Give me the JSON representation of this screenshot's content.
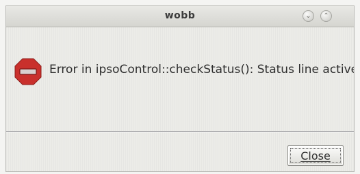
{
  "window": {
    "title": "wobb",
    "title_buttons": [
      {
        "name": "minimize",
        "icon": "chevron-down-icon",
        "glyph": "⌄"
      },
      {
        "name": "maximize",
        "icon": "chevron-up-icon",
        "glyph": "⌃"
      }
    ]
  },
  "dialog": {
    "icon": "stop-sign-icon",
    "icon_color": "#c9302c",
    "message": "Error in ipsoControl::checkStatus(): Status line active!"
  },
  "footer": {
    "close_label": "Close"
  },
  "colors": {
    "background": "#ecece8",
    "titlebar": "#d5d5d0",
    "text": "#2e2e2e"
  }
}
